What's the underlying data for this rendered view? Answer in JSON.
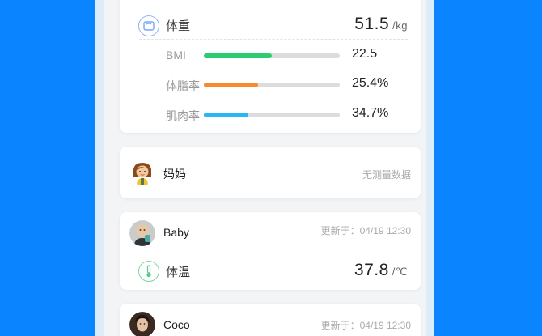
{
  "top_card": {
    "weight": {
      "label": "体重",
      "value": "51.5",
      "unit": "/kg",
      "icon": "scale-icon"
    },
    "metrics": [
      {
        "label": "BMI",
        "value": "22.5",
        "fraction": 0.5,
        "color": "#2ecc71"
      },
      {
        "label": "体脂率",
        "value": "25.4%",
        "fraction": 0.4,
        "color": "#f68a2e"
      },
      {
        "label": "肌肉率",
        "value": "34.7%",
        "fraction": 0.33,
        "color": "#29b6f6"
      }
    ]
  },
  "members": [
    {
      "name": "妈妈",
      "status": "无测量数据"
    },
    {
      "name": "Baby",
      "update_label": "更新于：04/19  12:30",
      "temperature": {
        "label": "体温",
        "value": "37.8",
        "unit": "/℃",
        "icon": "thermometer-icon"
      }
    },
    {
      "name": "Coco",
      "update_label": "更新于：04/19  12:30"
    }
  ]
}
